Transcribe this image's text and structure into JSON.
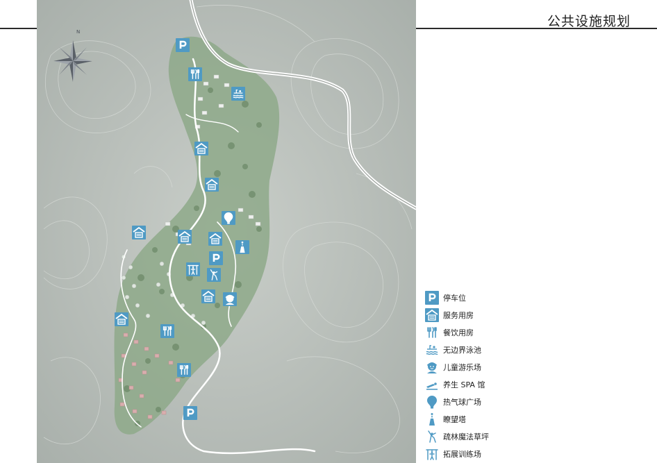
{
  "header": {
    "title": "公共设施规划"
  },
  "colors": {
    "accent": "#4f9ac4",
    "terrain": "#b7bdb8",
    "site_green": "#8ea98a",
    "road": "#ffffff",
    "villa_pink": "#d9aeae"
  },
  "map": {
    "compass_label": "N",
    "markers": [
      {
        "type": "parking",
        "icon": "parking-icon"
      },
      {
        "type": "dining",
        "icon": "dining-icon"
      },
      {
        "type": "pool",
        "icon": "infinity-pool-icon"
      },
      {
        "type": "service",
        "icon": "service-building-icon"
      },
      {
        "type": "service",
        "icon": "service-building-icon"
      },
      {
        "type": "balloon",
        "icon": "hot-air-balloon-icon"
      },
      {
        "type": "service",
        "icon": "service-building-icon"
      },
      {
        "type": "service",
        "icon": "service-building-icon"
      },
      {
        "type": "service",
        "icon": "service-building-icon"
      },
      {
        "type": "tower",
        "icon": "lookout-tower-icon"
      },
      {
        "type": "parking",
        "icon": "parking-icon"
      },
      {
        "type": "training",
        "icon": "outward-training-icon"
      },
      {
        "type": "forest_lawn",
        "icon": "forest-lawn-icon"
      },
      {
        "type": "service",
        "icon": "service-building-icon"
      },
      {
        "type": "playground",
        "icon": "playground-icon"
      },
      {
        "type": "service",
        "icon": "service-building-icon"
      },
      {
        "type": "dining",
        "icon": "dining-icon"
      },
      {
        "type": "dining",
        "icon": "dining-icon"
      },
      {
        "type": "parking",
        "icon": "parking-icon"
      }
    ]
  },
  "legend": {
    "items": [
      {
        "label": "停车位",
        "icon": "parking-icon"
      },
      {
        "label": "服务用房",
        "icon": "service-building-icon"
      },
      {
        "label": "餐饮用房",
        "icon": "dining-icon"
      },
      {
        "label": "无边界泳池",
        "icon": "infinity-pool-icon"
      },
      {
        "label": "儿童游乐场",
        "icon": "playground-icon"
      },
      {
        "label": "养生 SPA 馆",
        "icon": "spa-icon"
      },
      {
        "label": "热气球广场",
        "icon": "hot-air-balloon-icon"
      },
      {
        "label": "瞭望塔",
        "icon": "lookout-tower-icon"
      },
      {
        "label": "疏林魔法草坪",
        "icon": "forest-lawn-icon"
      },
      {
        "label": "拓展训练场",
        "icon": "outward-training-icon"
      }
    ]
  }
}
